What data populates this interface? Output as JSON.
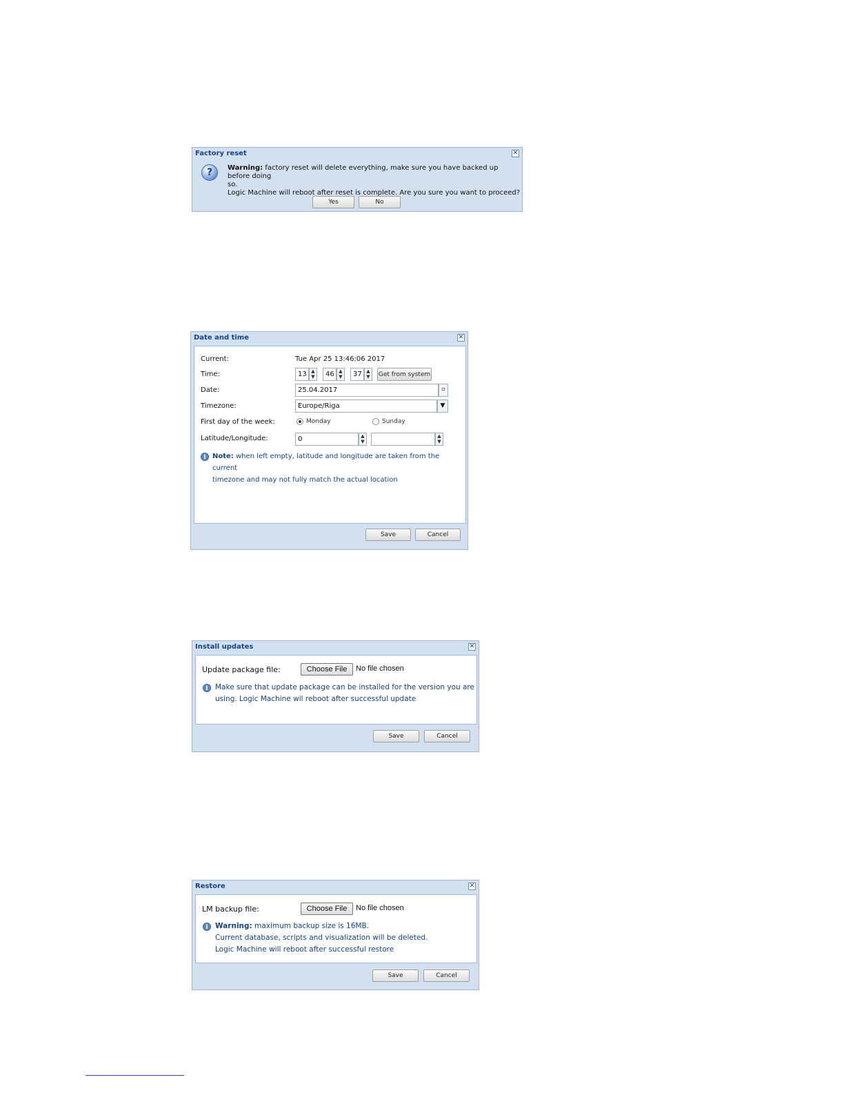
{
  "factory_reset": {
    "title": "Factory reset",
    "warning_bold": "Warning:",
    "line1": " factory reset will delete everything, make sure you have backed up before doing",
    "line2": "so.",
    "line3": "Logic Machine will reboot after reset is complete. Are you sure you want to proceed?",
    "yes": "Yes",
    "no": "No",
    "icon": "question-icon"
  },
  "date_time": {
    "title": "Date and time",
    "current_label": "Current:",
    "current_value": "Tue Apr 25 13:46:06 2017",
    "time_label": "Time:",
    "hour": "13",
    "minute": "46",
    "second": "37",
    "get_from_system": "Get from system",
    "date_label": "Date:",
    "date_value": "25.04.2017",
    "timezone_label": "Timezone:",
    "timezone_value": "Europe/Riga",
    "first_day_label": "First day of the week:",
    "monday": "Monday",
    "sunday": "Sunday",
    "first_day_selected": "Monday",
    "latlon_label": "Latitude/Longitude:",
    "latitude": "0",
    "longitude": "",
    "note_bold": "Note:",
    "note_line1": " when left empty, latitude and longitude are taken from the current",
    "note_line2": "timezone and may not fully match the actual location",
    "save": "Save",
    "cancel": "Cancel"
  },
  "install_updates": {
    "title": "Install updates",
    "file_label": "Update package file:",
    "choose_file": "Choose File",
    "no_file": "No file chosen",
    "note_line1": "Make sure that update package can be installed for the version you are",
    "note_line2": "using. Logic Machine wil reboot after successful update",
    "save": "Save",
    "cancel": "Cancel"
  },
  "restore": {
    "title": "Restore",
    "file_label": "LM backup file:",
    "choose_file": "Choose File",
    "no_file": "No file chosen",
    "warning_bold": "Warning:",
    "line1": " maximum backup size is 16MB.",
    "line2": "Current database, scripts and visualization will be deleted.",
    "line3": "Logic Machine will reboot after successful restore",
    "save": "Save",
    "cancel": "Cancel"
  },
  "colors": {
    "title_text": "#15428b",
    "dialog_frame": "#d3e0f0",
    "border": "#99bbe8"
  }
}
